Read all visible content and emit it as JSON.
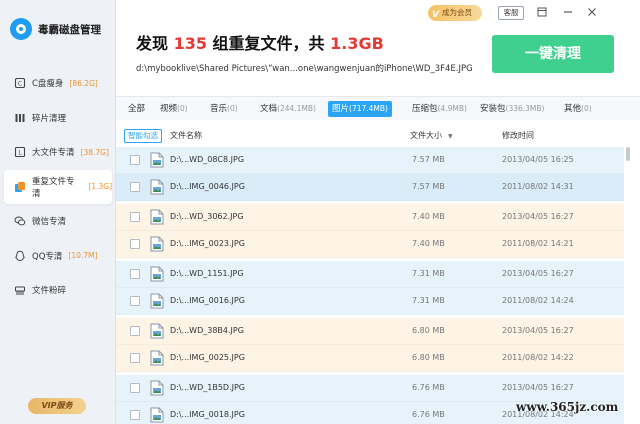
{
  "app": {
    "name": "毒霸磁盘管理"
  },
  "sidebar": {
    "items": [
      {
        "label": "C盘瘦身",
        "badge": "[86.2G]",
        "icon": "c-drive-icon"
      },
      {
        "label": "碎片清理",
        "badge": "",
        "icon": "fragment-icon"
      },
      {
        "label": "大文件专清",
        "badge": "[38.7G]",
        "icon": "large-file-icon"
      },
      {
        "label": "重复文件专清",
        "badge": "[1.3G]",
        "icon": "duplicate-file-icon",
        "active": true
      },
      {
        "label": "微信专清",
        "badge": "",
        "icon": "wechat-icon"
      },
      {
        "label": "QQ专清",
        "badge": "[10.7M]",
        "icon": "qq-icon"
      },
      {
        "label": "文件粉碎",
        "badge": "",
        "icon": "shredder-icon"
      }
    ],
    "vip_label": "VIP服务"
  },
  "topbar": {
    "vip_tag": "成为会员",
    "vip_crown": "V",
    "service": "客服",
    "window_icons": [
      "skin-icon",
      "minimize-icon",
      "close-icon"
    ]
  },
  "header": {
    "prefix": "发现 ",
    "count": "135",
    "middle": " 组重复文件，共 ",
    "size": "1.3GB",
    "path": "d:\\mybooklive\\Shared Pictures\\“wan...one\\wangwenjuan的iPhone\\WD_3F4E.JPG",
    "clean_button": "一键清理"
  },
  "tabs": [
    {
      "label": "全部",
      "count": ""
    },
    {
      "label": "视频",
      "count": "(0)"
    },
    {
      "label": "音乐",
      "count": "(0)"
    },
    {
      "label": "文档",
      "count": "(244.1MB)"
    },
    {
      "label": "图片",
      "count": "(717.4MB)",
      "active": true
    },
    {
      "label": "压缩包",
      "count": "(4.9MB)"
    },
    {
      "label": "安装包",
      "count": "(336.3MB)"
    },
    {
      "label": "其他",
      "count": "(0)"
    }
  ],
  "table": {
    "smart_select": "智能勾选",
    "columns": {
      "name": "文件名称",
      "size": "文件大小",
      "sort_icon": "sort-down-icon",
      "date": "修改时间"
    },
    "rows": [
      {
        "name": "D:\\...WD_08C8.JPG",
        "size": "7.57 MB",
        "date": "2013/04/05 16:25",
        "group": "blue"
      },
      {
        "name": "D:\\...IMG_0046.JPG",
        "size": "7.57 MB",
        "date": "2011/08/02 14:31",
        "group": "hl"
      },
      {
        "name": "D:\\...WD_3062.JPG",
        "size": "7.40 MB",
        "date": "2013/04/05 16:27",
        "group": "orange"
      },
      {
        "name": "D:\\...IMG_0023.JPG",
        "size": "7.40 MB",
        "date": "2011/08/02 14:21",
        "group": "orange"
      },
      {
        "name": "D:\\...WD_1151.JPG",
        "size": "7.31 MB",
        "date": "2013/04/05 16:27",
        "group": "blue"
      },
      {
        "name": "D:\\...IMG_0016.JPG",
        "size": "7.31 MB",
        "date": "2011/08/02 14:24",
        "group": "blue"
      },
      {
        "name": "D:\\...WD_38B4.JPG",
        "size": "6.80 MB",
        "date": "2013/04/05 16:27",
        "group": "orange"
      },
      {
        "name": "D:\\...IMG_0025.JPG",
        "size": "6.80 MB",
        "date": "2011/08/02 14:22",
        "group": "orange"
      },
      {
        "name": "D:\\...WD_1B5D.JPG",
        "size": "6.76 MB",
        "date": "2013/04/05 16:27",
        "group": "blue"
      },
      {
        "name": "D:\\...IMG_0018.JPG",
        "size": "6.76 MB",
        "date": "2011/08/02 14:24",
        "group": "blue"
      }
    ]
  },
  "watermark": "www.365jz.com"
}
